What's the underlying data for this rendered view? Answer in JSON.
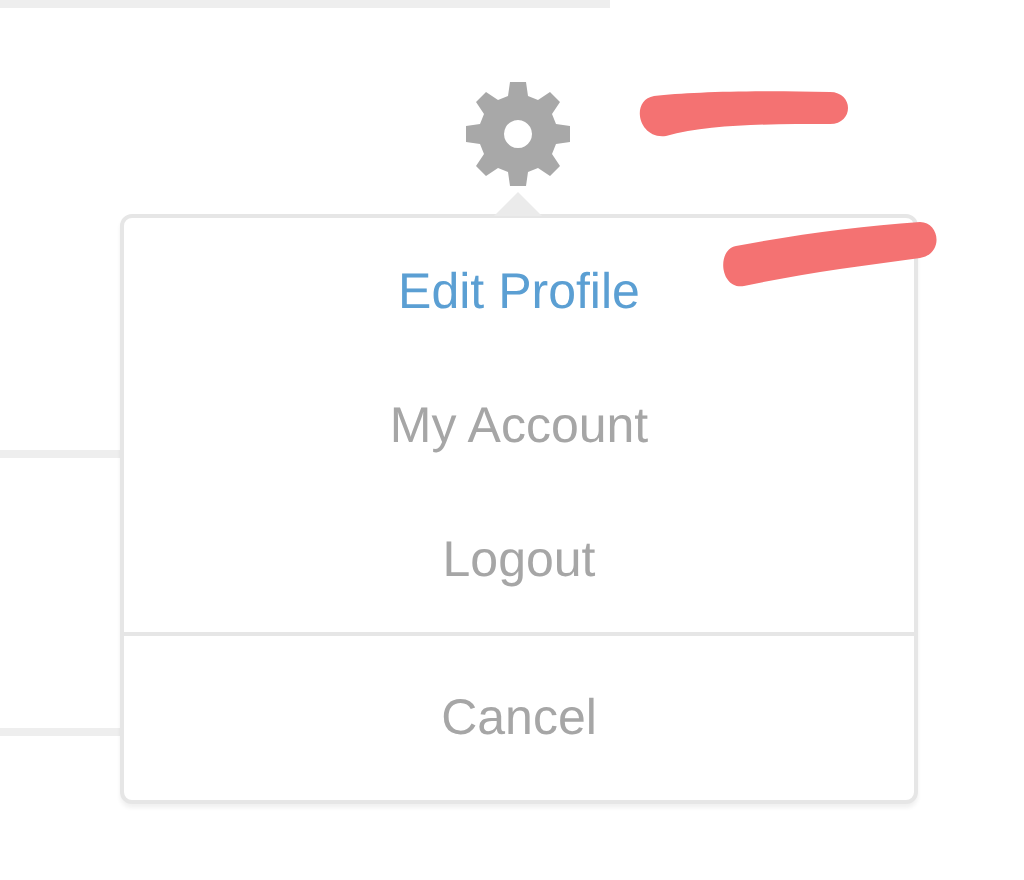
{
  "menu_items": [
    {
      "label": "Edit Profile",
      "selected": true
    },
    {
      "label": "My Account",
      "selected": false
    },
    {
      "label": "Logout",
      "selected": false
    }
  ],
  "cancel": {
    "label": "Cancel"
  }
}
